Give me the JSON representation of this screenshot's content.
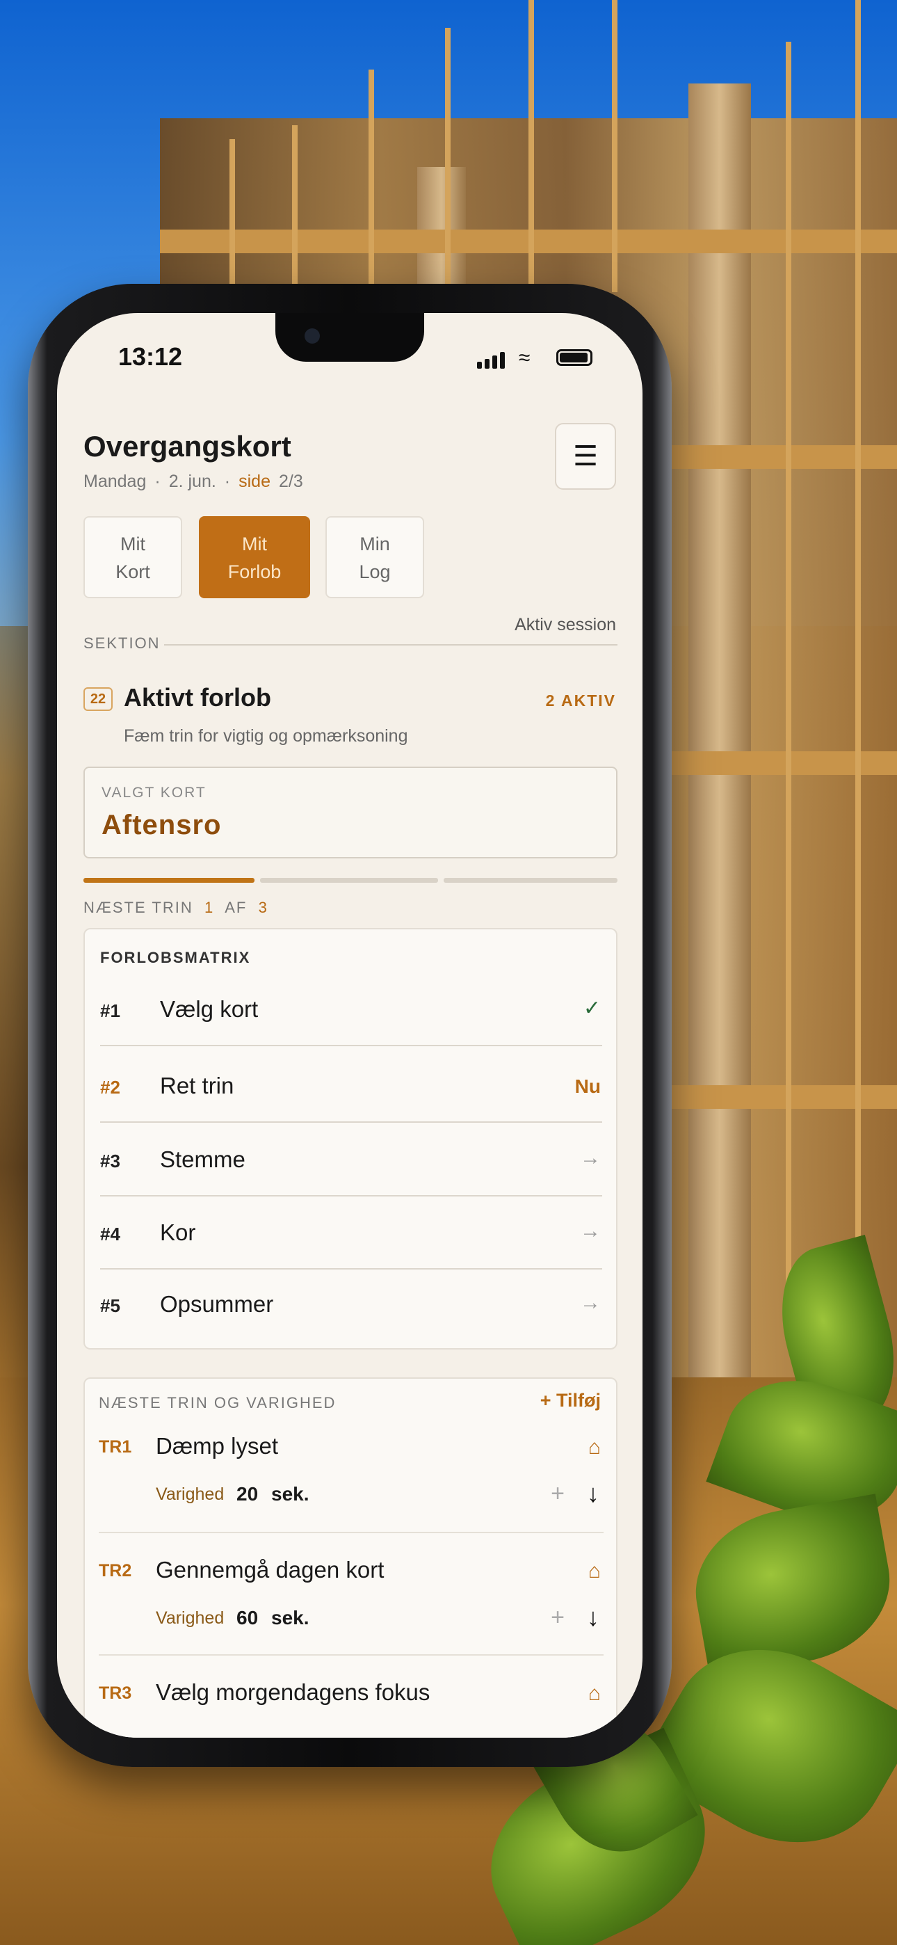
{
  "status_bar": {
    "time": "13:12"
  },
  "header": {
    "title": "Overgangskort",
    "day": "Mandag",
    "date": "2. jun.",
    "page_label": "side",
    "page_value": "2/3",
    "menu_icon": "menu-icon"
  },
  "tabs": [
    {
      "line1": "Mit",
      "line2": "Kort",
      "active": false
    },
    {
      "line1": "Mit",
      "line2": "Forlob",
      "active": true
    },
    {
      "line1": "Min",
      "line2": "Log",
      "active": false
    }
  ],
  "section": {
    "label": "SEKTION",
    "session": "Aktiv session",
    "badge": "22",
    "title": "Aktivt forlob",
    "count": "2 AKTIV",
    "description": "Fæm trin for vigtig og opmærksoning"
  },
  "selected_card": {
    "label": "VALGT KORT",
    "value": "Aftensro"
  },
  "progress": {
    "current": 1,
    "total": 3,
    "label": "NÆSTE TRIN",
    "of": "AF"
  },
  "matrix": {
    "heading": "FORLOBSMATRIX",
    "rows": [
      {
        "num": "#1",
        "title": "Vælg kort",
        "status": "✓"
      },
      {
        "num": "#2",
        "title": "Ret trin",
        "status": "Nu"
      },
      {
        "num": "#3",
        "title": "Stemme",
        "status": "→"
      },
      {
        "num": "#4",
        "title": "Kor",
        "status": "→"
      },
      {
        "num": "#5",
        "title": "Opsummer",
        "status": "→"
      }
    ]
  },
  "next_steps": {
    "heading": "NÆSTE TRIN OG VARIGHED",
    "add_label": "Tilføj",
    "duration_label": "Varighed",
    "unit": "sek.",
    "items": [
      {
        "id": "TR1",
        "name": "Dæmp lyset",
        "duration": "20"
      },
      {
        "id": "TR2",
        "name": "Gennemgå dagen kort",
        "duration": "60"
      },
      {
        "id": "TR3",
        "name": "Vælg morgendagens fokus",
        "duration": ""
      }
    ]
  },
  "colors": {
    "accent": "#c06e16",
    "accent_text": "#b86a14",
    "screen_bg": "#f5f0e8"
  }
}
